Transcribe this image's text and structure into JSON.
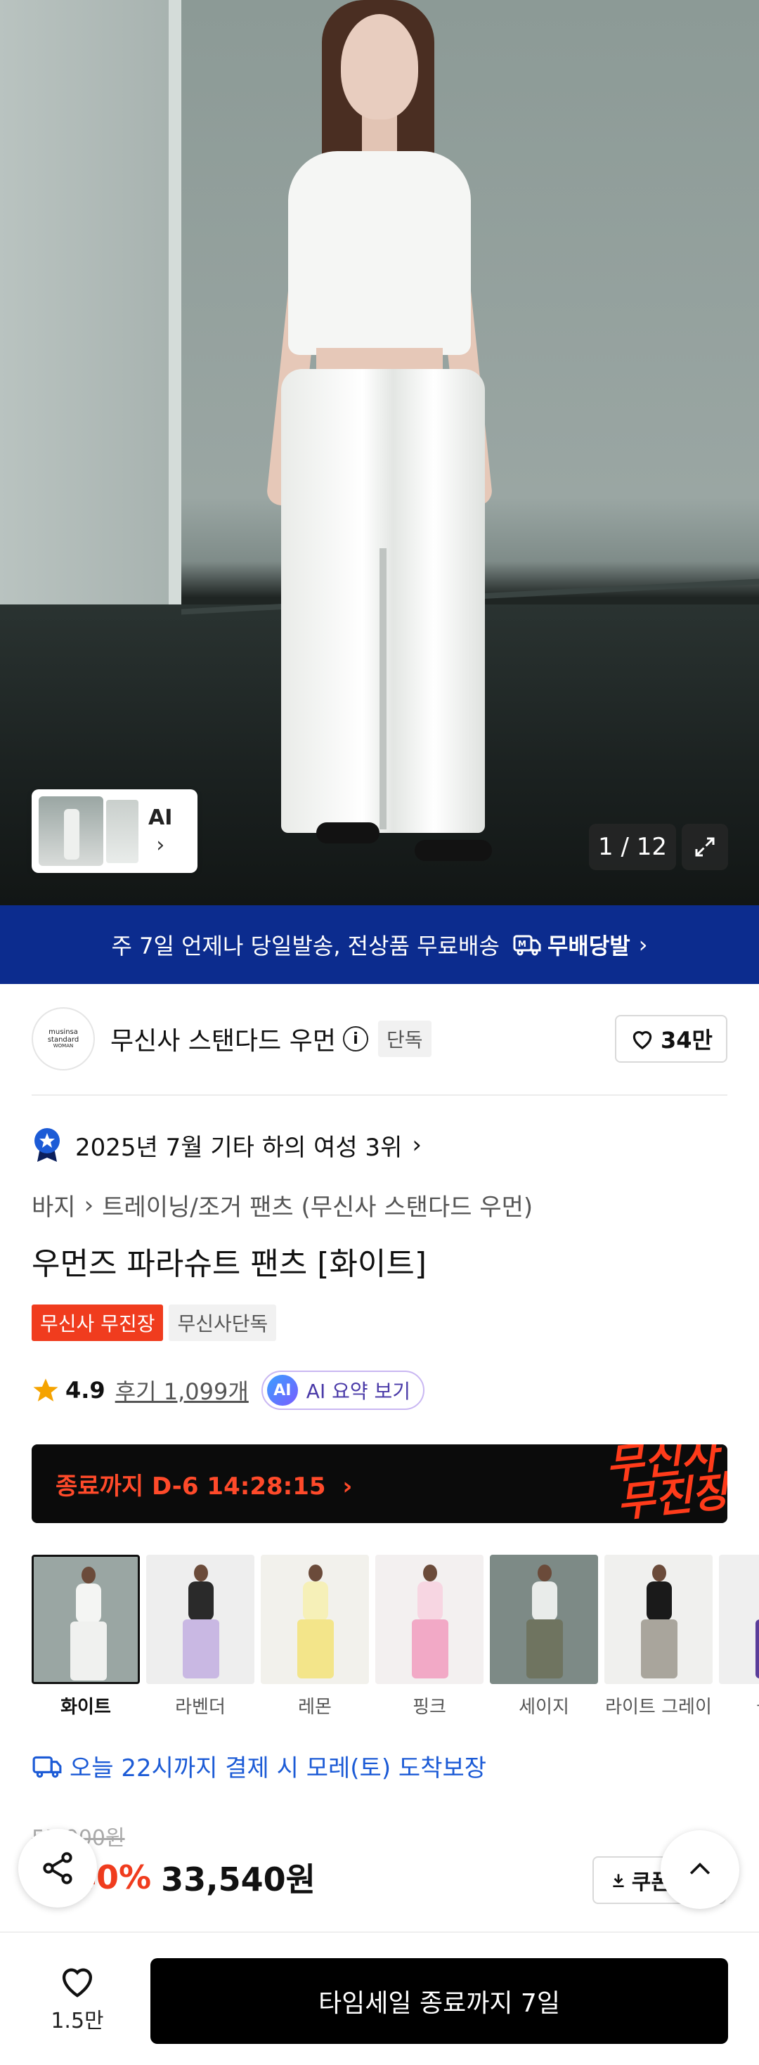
{
  "hero": {
    "pager": "1 / 12",
    "ai_label": "AI"
  },
  "banner": {
    "text": "주 7일 언제나 당일발송, 전상품 무료배송",
    "badge": "무배당발"
  },
  "brand": {
    "name": "무신사 스탠다드 우먼",
    "logo_line1": "musinsa",
    "logo_line2": "standard",
    "logo_line3": "WOMAN",
    "exclusive_tag": "단독",
    "likes": "34만"
  },
  "rank": {
    "text": "2025년 7월 기타 하의 여성 3위"
  },
  "breadcrumb": {
    "level1": "바지",
    "level2": "트레이닝/조거 팬츠 (무신사 스탠다드 우먼)"
  },
  "product": {
    "title": "우먼즈 파라슈트 팬츠 [화이트]",
    "tag_event": "무신사 무진장",
    "tag_exclusive": "무신사단독",
    "rating": "4.9",
    "reviews": "후기 1,099개",
    "ai_summary": "AI 요약 보기",
    "ai_badge": "AI"
  },
  "promo": {
    "countdown": "종료까지 D-6 14:28:15",
    "chevron": "›",
    "brand_line1": "무신사",
    "brand_line2": "무진장"
  },
  "colors": [
    {
      "label": "화이트",
      "top": "#f4f5f3",
      "bottom": "#f0f1ef",
      "bg": "#9aa6a3",
      "selected": true
    },
    {
      "label": "라벤더",
      "top": "#2a2a2a",
      "bottom": "#c9b8e3",
      "bg": "#eeeeee",
      "selected": false
    },
    {
      "label": "레몬",
      "top": "#f6f0b8",
      "bottom": "#f3e58a",
      "bg": "#f2f1ec",
      "selected": false
    },
    {
      "label": "핑크",
      "top": "#f7d6e2",
      "bottom": "#f2a9c6",
      "bg": "#f3f0f0",
      "selected": false
    },
    {
      "label": "세이지",
      "top": "#e9ecea",
      "bottom": "#6f7460",
      "bg": "#7d8a86",
      "selected": false
    },
    {
      "label": "라이트 그레이",
      "top": "#1a1a1a",
      "bottom": "#a9a59c",
      "bg": "#f0f0ee",
      "selected": false
    },
    {
      "label": "블랙",
      "top": "#222222",
      "bottom": "#5a3d9a",
      "bg": "#efefef",
      "selected": false
    }
  ],
  "delivery": {
    "text": "오늘 22시까지 결제 시 모레(토) 도착보장"
  },
  "price": {
    "original": "55,900원",
    "discount": "40%",
    "final": "33,540원",
    "coupon": "쿠폰받기"
  },
  "bottom": {
    "wish_count": "1.5만",
    "cta": "타임세일 종료까지 7일"
  },
  "theme": {
    "banner_blue": "#0c2c8e",
    "accent_red": "#f03c1e",
    "delivery_blue": "#1c5bd6"
  }
}
